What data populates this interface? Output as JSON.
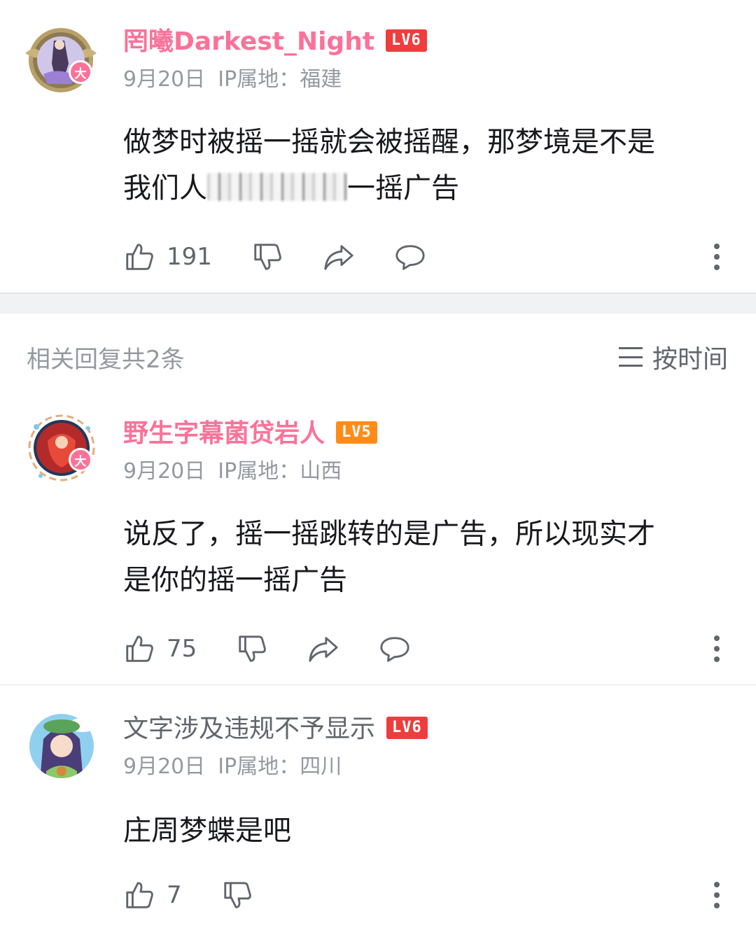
{
  "top_comment": {
    "username": "罔曦Darkest_Night",
    "level": "LV6",
    "date": "9月20日",
    "ip": "IP属地：福建",
    "text_line1": "做梦时被摇一摇就会被摇醒，那梦境是不是",
    "text_line2_start": "我们人",
    "text_line2_end": "一摇广告",
    "likes": "191",
    "colors": {
      "username": "#fb7299",
      "level_bg": "#ee3d3d"
    }
  },
  "replies_header": {
    "title": "相关回复共2条",
    "sort_label": "按时间"
  },
  "replies": [
    {
      "username": "野生字幕菌贷岩人",
      "level": "LV5",
      "date": "9月20日",
      "ip": "IP属地：山西",
      "text_line1": "说反了，摇一摇跳转的是广告，所以现实才",
      "text_line2": "是你的摇一摇广告",
      "likes": "75"
    },
    {
      "username": "文字涉及违规不予显示",
      "level": "LV6",
      "date": "9月20日",
      "ip": "IP属地：四川",
      "text_line1": "庄周梦蝶是吧",
      "likes": "7"
    }
  ],
  "icons": [
    "like-icon",
    "dislike-icon",
    "share-icon",
    "reply-icon",
    "more-icon",
    "sort-icon"
  ]
}
